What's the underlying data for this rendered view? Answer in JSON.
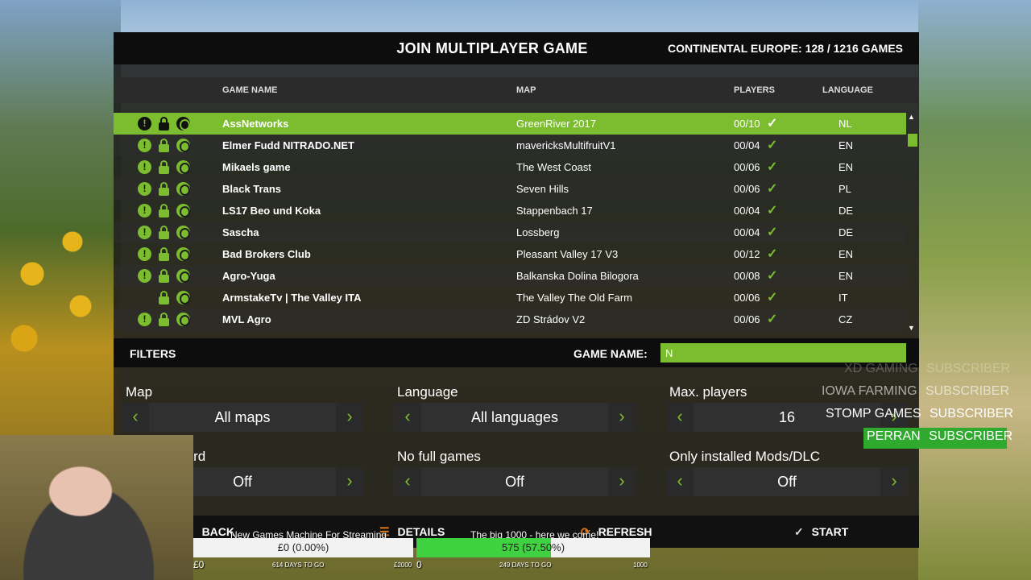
{
  "window": {
    "title": "JOIN MULTIPLAYER GAME",
    "server_info": "CONTINENTAL EUROPE: 128 / 1216 GAMES"
  },
  "columns": {
    "game_name": "GAME NAME",
    "map": "MAP",
    "players": "PLAYERS",
    "language": "LANGUAGE"
  },
  "games": [
    {
      "name": "AssNetworks",
      "map": "GreenRiver 2017",
      "players": "00/10",
      "language": "NL",
      "warning": true,
      "selected": true
    },
    {
      "name": "Elmer Fudd NITRADO.NET",
      "map": "mavericksMultifruitV1",
      "players": "00/04",
      "language": "EN",
      "warning": true
    },
    {
      "name": "Mikaels game",
      "map": "The West Coast",
      "players": "00/06",
      "language": "EN",
      "warning": true
    },
    {
      "name": "Black Trans",
      "map": "Seven Hills",
      "players": "00/06",
      "language": "PL",
      "warning": true
    },
    {
      "name": "LS17 Beo und Koka",
      "map": "Stappenbach 17",
      "players": "00/04",
      "language": "DE",
      "warning": true
    },
    {
      "name": "Sascha",
      "map": "Lossberg",
      "players": "00/04",
      "language": "DE",
      "warning": true
    },
    {
      "name": "Bad Brokers Club",
      "map": "Pleasant Valley 17 V3",
      "players": "00/12",
      "language": "EN",
      "warning": true
    },
    {
      "name": "Agro-Yuga",
      "map": "Balkanska Dolina Bilogora",
      "players": "00/08",
      "language": "EN",
      "warning": true
    },
    {
      "name": "ArmstakeTv | The Valley ITA",
      "map": "The Valley The Old Farm",
      "players": "00/06",
      "language": "IT",
      "warning": false
    },
    {
      "name": "MVL Agro",
      "map": "ZD Strádov V2",
      "players": "00/06",
      "language": "CZ",
      "warning": true
    }
  ],
  "filters": {
    "label": "FILTERS",
    "game_name_label": "GAME NAME:",
    "game_name_value": "N",
    "map": {
      "label": "Map",
      "value": "All maps"
    },
    "language": {
      "label": "Language",
      "value": "All languages"
    },
    "max_players": {
      "label": "Max. players",
      "value": "16"
    },
    "no_password": {
      "label": "No password",
      "value": "Off"
    },
    "no_full_games": {
      "label": "No full games",
      "value": "Off"
    },
    "installed_mods": {
      "label": "Only installed Mods/DLC",
      "value": "Off"
    }
  },
  "buttons": {
    "back": "BACK",
    "details": "DETAILS",
    "refresh": "REFRESH",
    "start": "START"
  },
  "overlay": {
    "subscribers": [
      {
        "name": "XD GAMING",
        "tag": "SUBSCRIBER"
      },
      {
        "name": "IOWA FARMING",
        "tag": "SUBSCRIBER"
      },
      {
        "name": "STOMP GAMES",
        "tag": "SUBSCRIBER"
      },
      {
        "name": "PERRAN",
        "tag": "SUBSCRIBER"
      }
    ],
    "goal1": {
      "label": "New Games Machine For Streaming",
      "value": "£0 (0.00%)",
      "start": "£0",
      "days": "614 DAYS TO GO",
      "target": "£2000",
      "progress": 0.0
    },
    "goal2": {
      "label": "The big 1000 - here we come!",
      "value": "575 (57.50%)",
      "start": "0",
      "days": "249 DAYS TO GO",
      "target": "1000",
      "progress": 0.575
    }
  },
  "colors": {
    "accent": "#7cbd2f",
    "panel": "#1c1c1c",
    "header": "#0d0d0d"
  }
}
